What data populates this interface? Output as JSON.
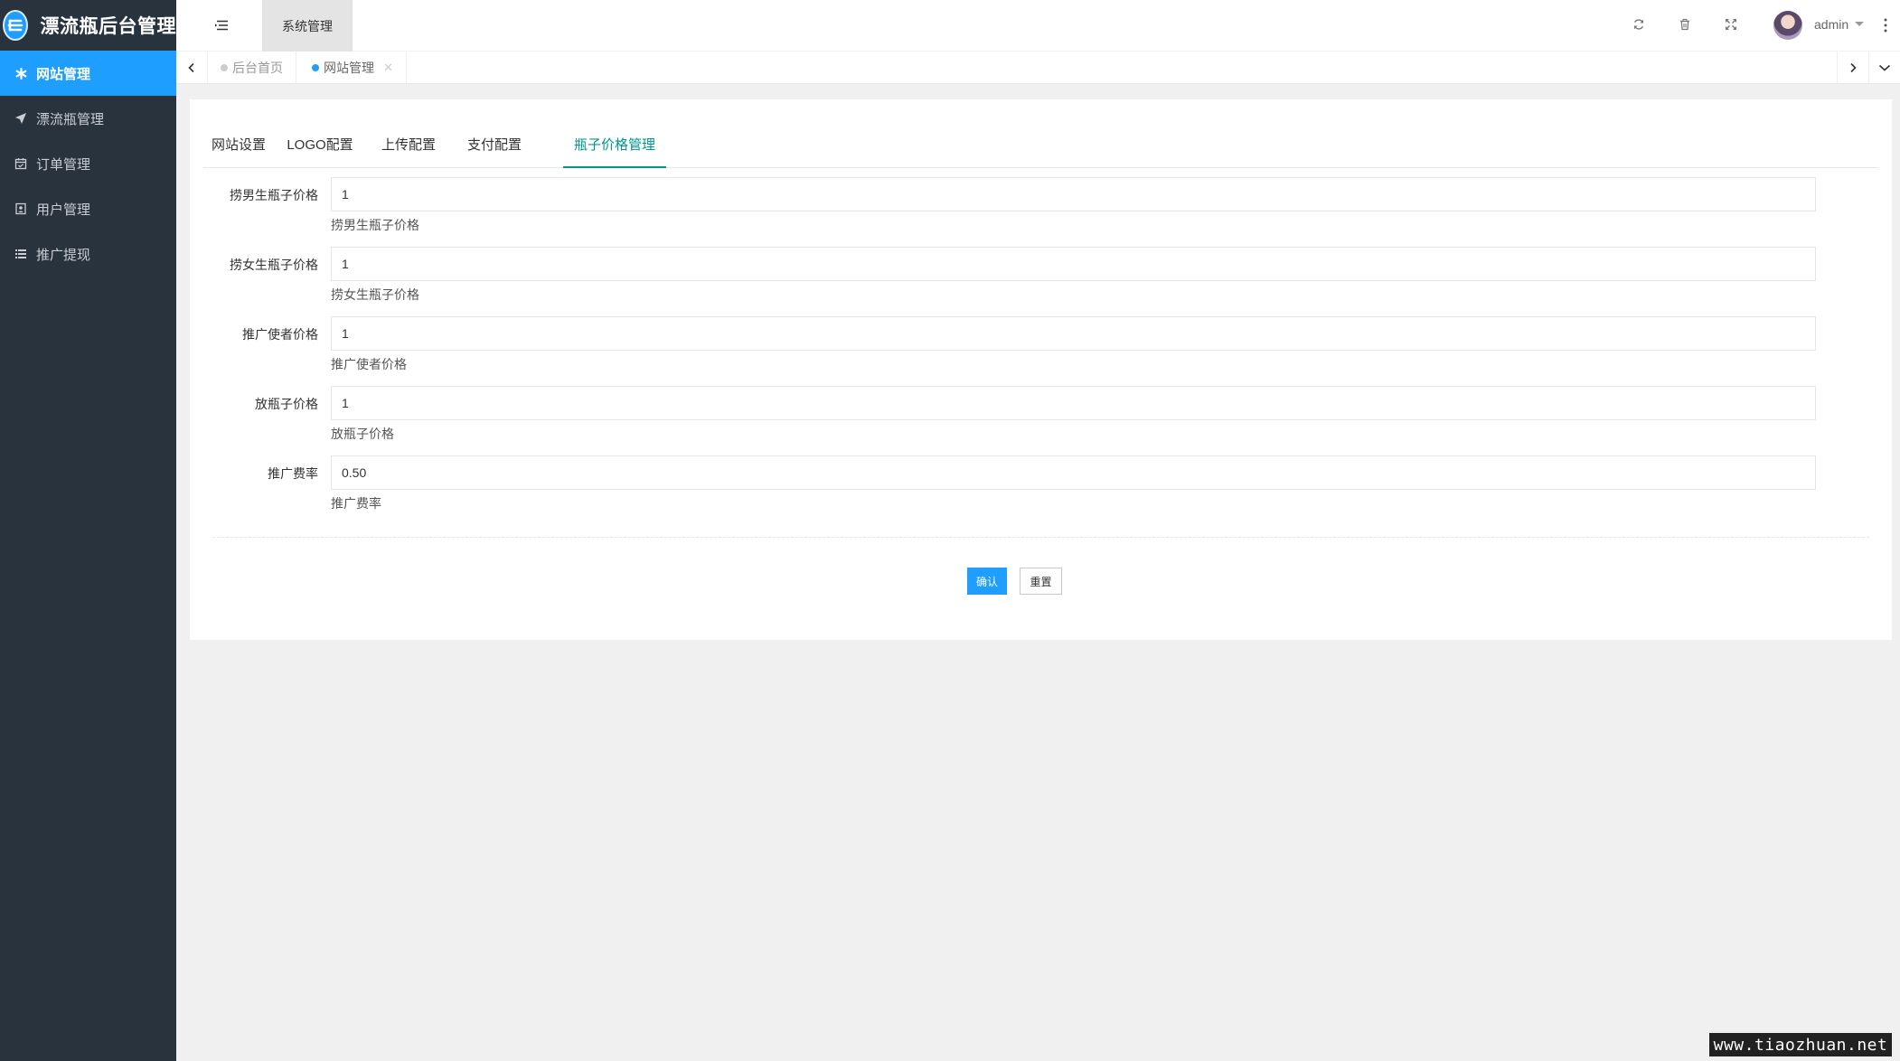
{
  "app": {
    "title": "漂流瓶后台管理"
  },
  "sidebar": {
    "items": [
      {
        "label": "网站管理",
        "icon": "gear-icon",
        "active": true
      },
      {
        "label": "漂流瓶管理",
        "icon": "rocket-icon",
        "active": false
      },
      {
        "label": "订单管理",
        "icon": "calendar-icon",
        "active": false
      },
      {
        "label": "用户管理",
        "icon": "user-card-icon",
        "active": false
      },
      {
        "label": "推广提现",
        "icon": "list-icon",
        "active": false
      }
    ]
  },
  "header": {
    "top_tab": "系统管理",
    "user": "admin",
    "icons": [
      "menu-toggle-icon",
      "refresh-icon",
      "trash-icon",
      "fullscreen-icon",
      "more-vertical-icon"
    ]
  },
  "page_tabs": [
    {
      "label": "后台首页",
      "active": false
    },
    {
      "label": "网站管理",
      "active": true
    }
  ],
  "tabs": [
    {
      "label": "网站设置",
      "active": false
    },
    {
      "label": "LOGO配置",
      "active": false
    },
    {
      "label": "上传配置",
      "active": false
    },
    {
      "label": "支付配置",
      "active": false
    },
    {
      "label": "瓶子价格管理",
      "active": true
    }
  ],
  "form": {
    "fields": [
      {
        "label": "捞男生瓶子价格",
        "value": "1",
        "help": "捞男生瓶子价格"
      },
      {
        "label": "捞女生瓶子价格",
        "value": "1",
        "help": "捞女生瓶子价格"
      },
      {
        "label": "推广使者价格",
        "value": "1",
        "help": "推广使者价格"
      },
      {
        "label": "放瓶子价格",
        "value": "1",
        "help": "放瓶子价格"
      },
      {
        "label": "推广费率",
        "value": "0.50",
        "help": "推广费率"
      }
    ],
    "confirm_label": "确认",
    "reset_label": "重置"
  },
  "watermark": "www.tiaozhuan.net",
  "colors": {
    "sidebar_bg": "#28333e",
    "primary": "#1e9fff",
    "tab_active": "#009688"
  }
}
